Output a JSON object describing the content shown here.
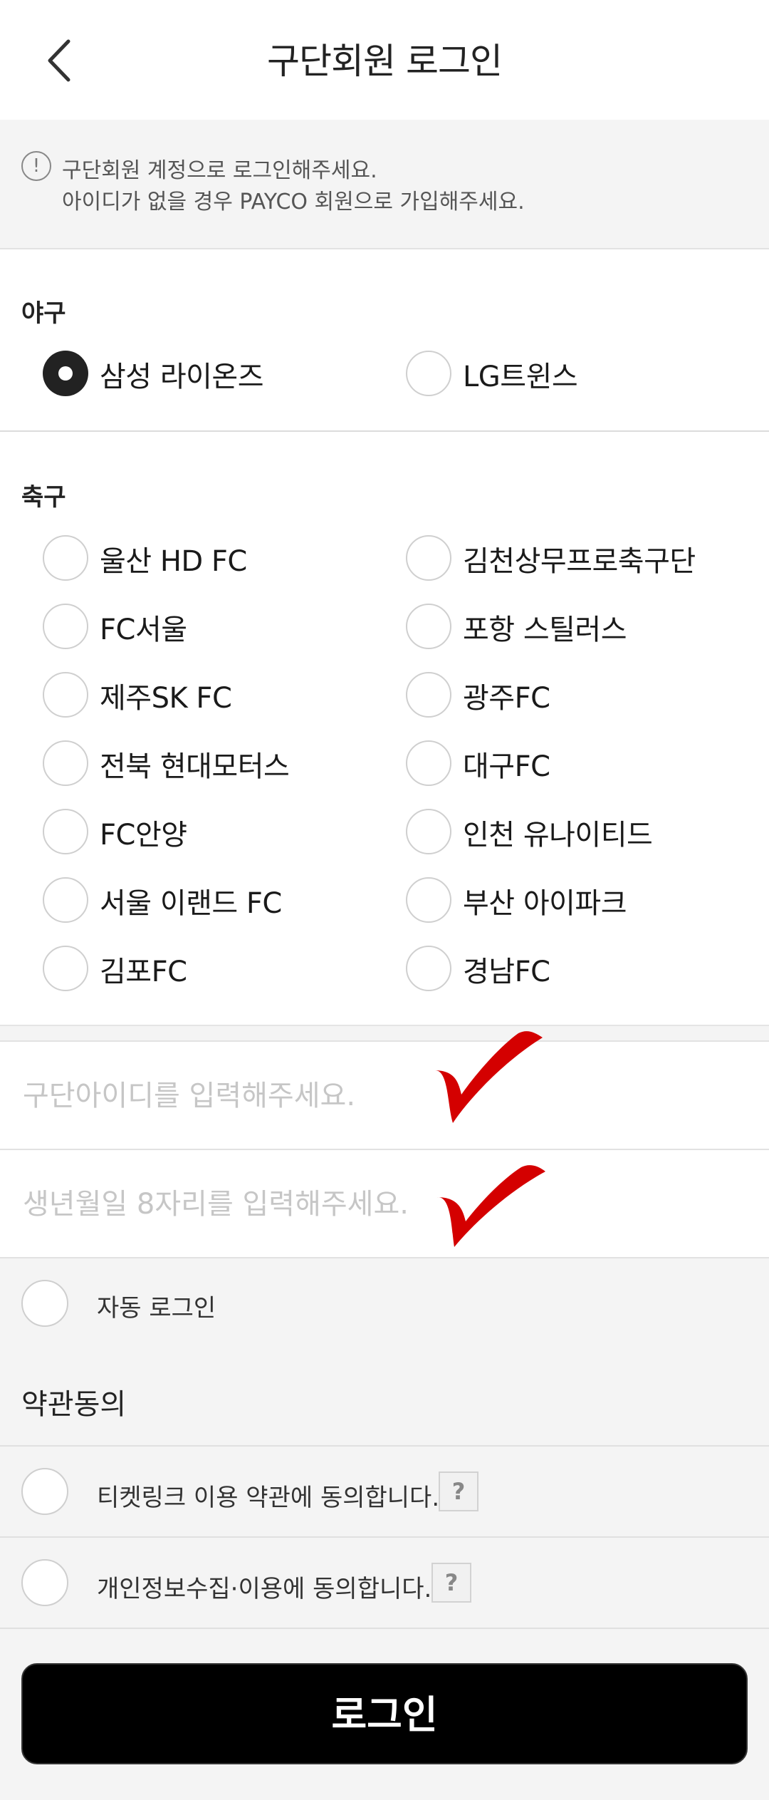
{
  "header": {
    "title": "구단회원 로그인",
    "back_icon": "chevron-left-icon"
  },
  "notice": {
    "icon": "exclamation-circle-icon",
    "line1": "구단회원 계정으로 로그인해주세요.",
    "line2": "아이디가 없을 경우 PAYCO 회원으로 가입해주세요."
  },
  "baseball": {
    "label": "야구",
    "options": [
      {
        "label": "삼성 라이온즈",
        "selected": true
      },
      {
        "label": "LG트윈스",
        "selected": false
      }
    ]
  },
  "soccer": {
    "label": "축구",
    "options": [
      {
        "label": "울산 HD FC"
      },
      {
        "label": "김천상무프로축구단"
      },
      {
        "label": "FC서울"
      },
      {
        "label": "포항 스틸러스"
      },
      {
        "label": "제주SK FC"
      },
      {
        "label": "광주FC"
      },
      {
        "label": "전북 현대모터스"
      },
      {
        "label": "대구FC"
      },
      {
        "label": "FC안양"
      },
      {
        "label": "인천 유나이티드"
      },
      {
        "label": "서울 이랜드 FC"
      },
      {
        "label": "부산 아이파크"
      },
      {
        "label": "김포FC"
      },
      {
        "label": "경남FC"
      }
    ]
  },
  "form": {
    "id_placeholder": "구단아이디를 입력해주세요.",
    "birth_placeholder": "생년월일 8자리를 입력해주세요.",
    "id_value": "",
    "birth_value": "",
    "check_mark_color": "#d40000"
  },
  "auto_login": {
    "label": "자동 로그인"
  },
  "terms": {
    "title": "약관동의",
    "items": [
      {
        "label": "티켓링크 이용 약관에 동의합니다.",
        "help": "?"
      },
      {
        "label": "개인정보수집·이용에 동의합니다.",
        "help": "?"
      }
    ]
  },
  "login_button": {
    "label": "로그인"
  }
}
